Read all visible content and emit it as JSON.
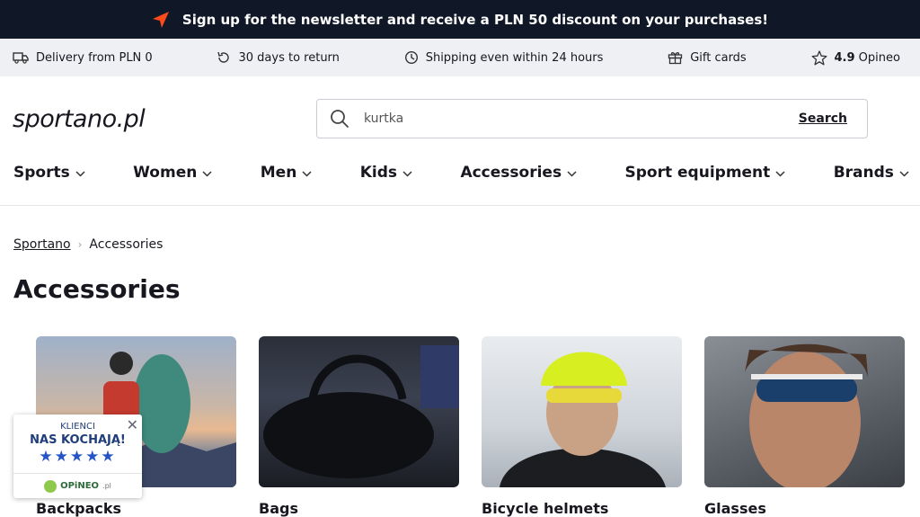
{
  "topbar": {
    "text": "Sign up for the newsletter and receive a PLN 50 discount on your purchases!",
    "accent": "#ff4a1c"
  },
  "infobar": {
    "items": [
      {
        "icon": "truck-icon",
        "text": "Delivery from PLN 0"
      },
      {
        "icon": "return-icon",
        "text": "30 days to return"
      },
      {
        "icon": "clock-icon",
        "text": "Shipping even within 24 hours"
      },
      {
        "icon": "gift-icon",
        "text": "Gift cards"
      }
    ],
    "rating": {
      "icon": "star-icon",
      "score": "4.9",
      "source": "Opineo"
    }
  },
  "header": {
    "logo": "sportano.pl",
    "search": {
      "value": "kurtka",
      "button": "Search"
    }
  },
  "nav": {
    "items": [
      "Sports",
      "Women",
      "Men",
      "Kids",
      "Accessories",
      "Sport equipment",
      "Brands"
    ]
  },
  "breadcrumb": {
    "home": "Sportano",
    "current": "Accessories"
  },
  "page": {
    "title": "Accessories"
  },
  "categories": [
    {
      "label": "Backpacks"
    },
    {
      "label": "Bags"
    },
    {
      "label": "Bicycle helmets"
    },
    {
      "label": "Glasses"
    }
  ],
  "badge": {
    "line1": "KLIENCI",
    "line2": "NAS KOCHAJĄ!",
    "stars": "★★★★★",
    "brand": "OPiNEO",
    "brand_suffix": ".pl"
  },
  "colors": {
    "dark": "#101828",
    "infobar_bg": "#eef0f4",
    "star_blue": "#2554c7"
  }
}
